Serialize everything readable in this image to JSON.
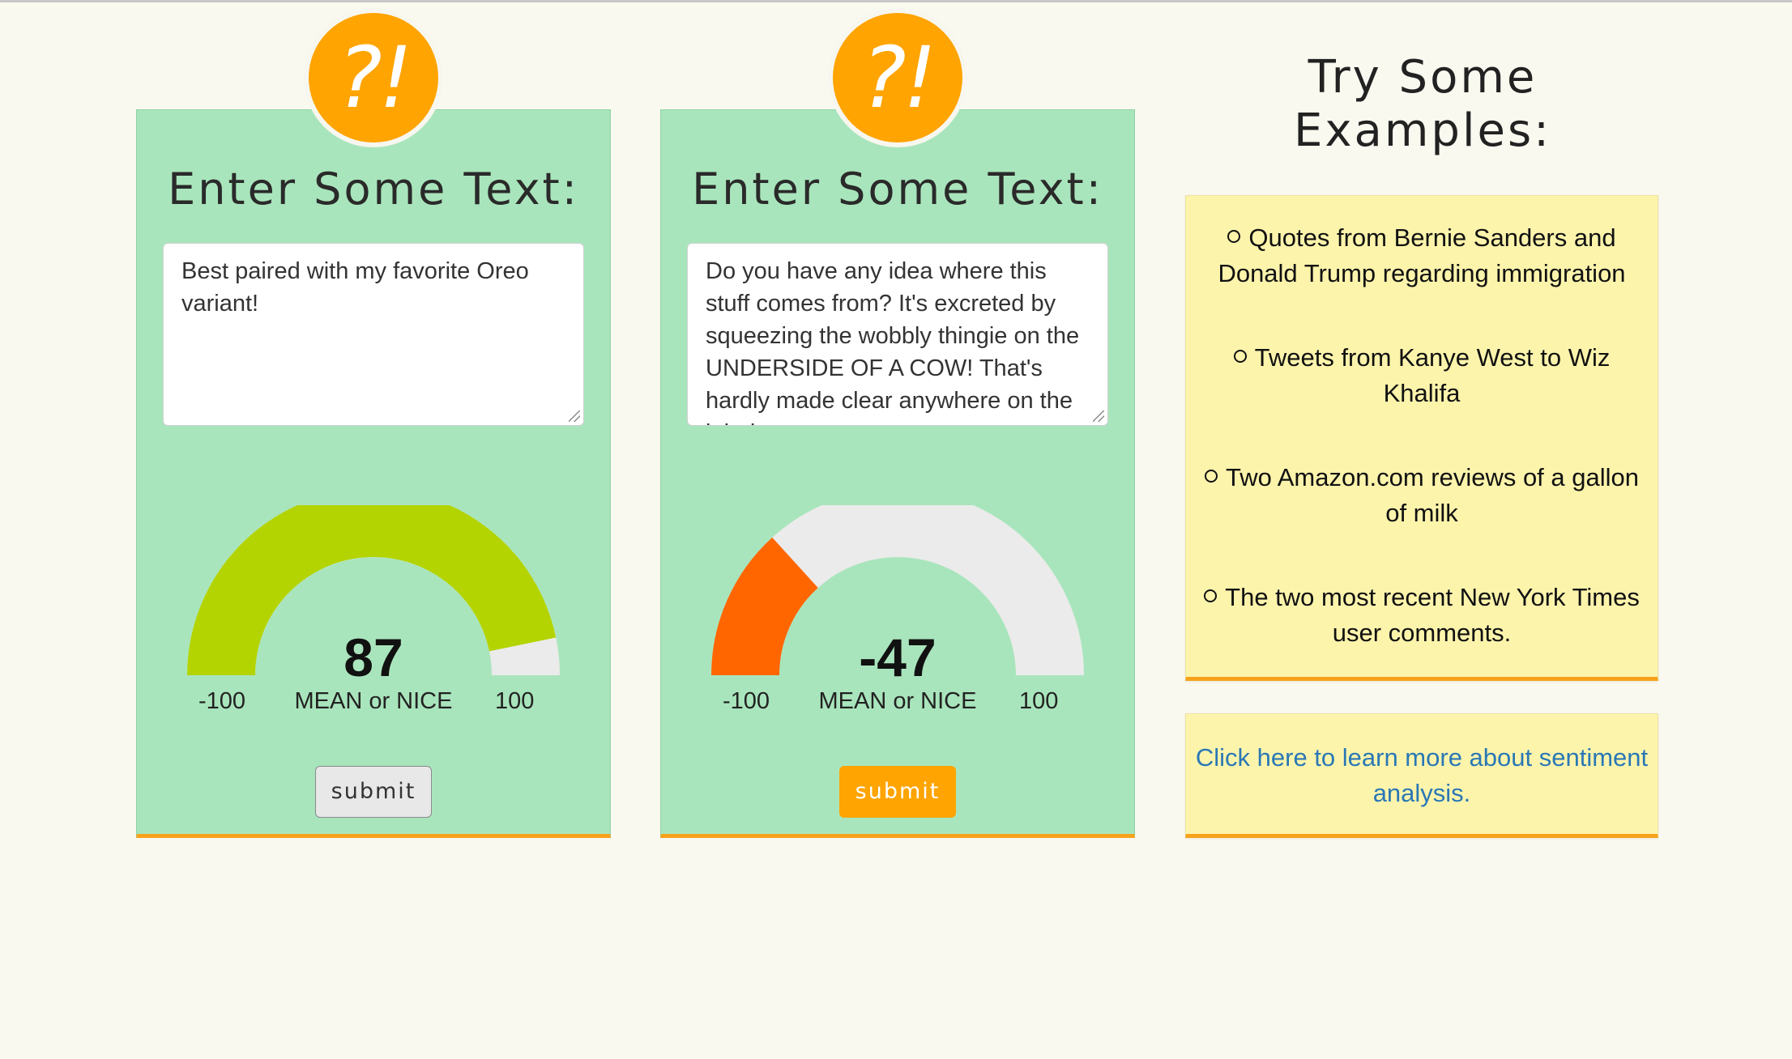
{
  "colors": {
    "background": "#faf9f0",
    "panel_green": "#a9e5bc",
    "accent_orange": "#ffa400",
    "note_yellow": "#fdf4ac",
    "gauge_positive": "#b3d400",
    "gauge_negative": "#ff6600",
    "gauge_track": "#ebebeb",
    "link_blue": "#2a78b5"
  },
  "panels": [
    {
      "badge": "?!",
      "title": "Enter Some Text:",
      "text": "Best paired with my favorite Oreo variant!",
      "gauge": {
        "value": 87,
        "display": "87",
        "min": "-100",
        "max": "100",
        "label": "MEAN or NICE"
      },
      "submit": "submit"
    },
    {
      "badge": "?!",
      "title": "Enter Some Text:",
      "text": "Do you have any idea where this stuff comes from? It's excreted by squeezing the wobbly thingie on the UNDERSIDE OF A COW! That's hardly made clear anywhere on the label.",
      "gauge": {
        "value": -47,
        "display": "-47",
        "min": "-100",
        "max": "100",
        "label": "MEAN or NICE"
      },
      "submit": "submit"
    }
  ],
  "examples": {
    "title_line1": "Try Some",
    "title_line2": "Examples:",
    "items": [
      "Quotes from Bernie Sanders and Donald Trump regarding immigration",
      "Tweets from Kanye West to Wiz Khalifa",
      "Two Amazon.com reviews of a gallon of milk",
      "The two most recent New York Times user comments."
    ]
  },
  "learn_more": "Click here to learn more about sentiment analysis."
}
